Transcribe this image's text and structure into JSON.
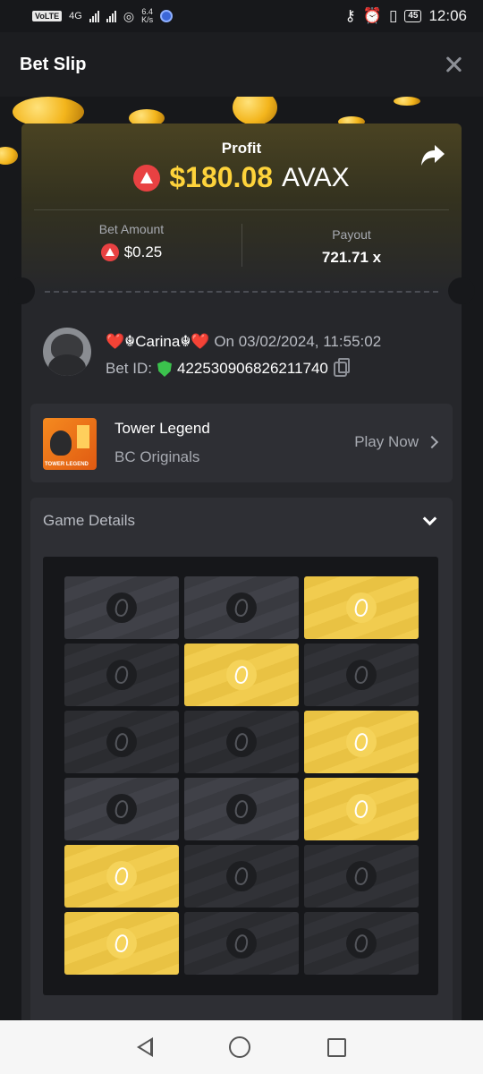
{
  "status_bar": {
    "volte": "VoLTE",
    "network": "4G",
    "speed_value": "6.4",
    "speed_unit": "K/s",
    "battery": "45",
    "time": "12:06"
  },
  "header": {
    "title": "Bet Slip"
  },
  "profit": {
    "label": "Profit",
    "amount": "$180.08",
    "currency": "AVAX"
  },
  "bet_amount": {
    "label": "Bet Amount",
    "value": "$0.25"
  },
  "payout": {
    "label": "Payout",
    "value": "721.71 x"
  },
  "player": {
    "name": "❤️☬Carina☬❤️",
    "date": "On 03/02/2024, 11:55:02",
    "bet_id_label": "Bet ID:",
    "bet_id": "422530906826211740"
  },
  "game": {
    "thumb_text": "TOWER LEGEND",
    "name": "Tower Legend",
    "provider": "BC Originals",
    "play_label": "Play Now"
  },
  "details": {
    "title": "Game Details",
    "tile_states": [
      [
        "grey",
        "grey",
        "gold"
      ],
      [
        "dim",
        "gold",
        "dim"
      ],
      [
        "dim",
        "dim",
        "gold"
      ],
      [
        "grey",
        "grey",
        "gold"
      ],
      [
        "gold",
        "dim",
        "dim"
      ],
      [
        "gold",
        "dim",
        "dim"
      ]
    ]
  },
  "colors": {
    "accent_gold": "#fed33b",
    "avax_red": "#e84142",
    "verified_green": "#3bc24d"
  }
}
